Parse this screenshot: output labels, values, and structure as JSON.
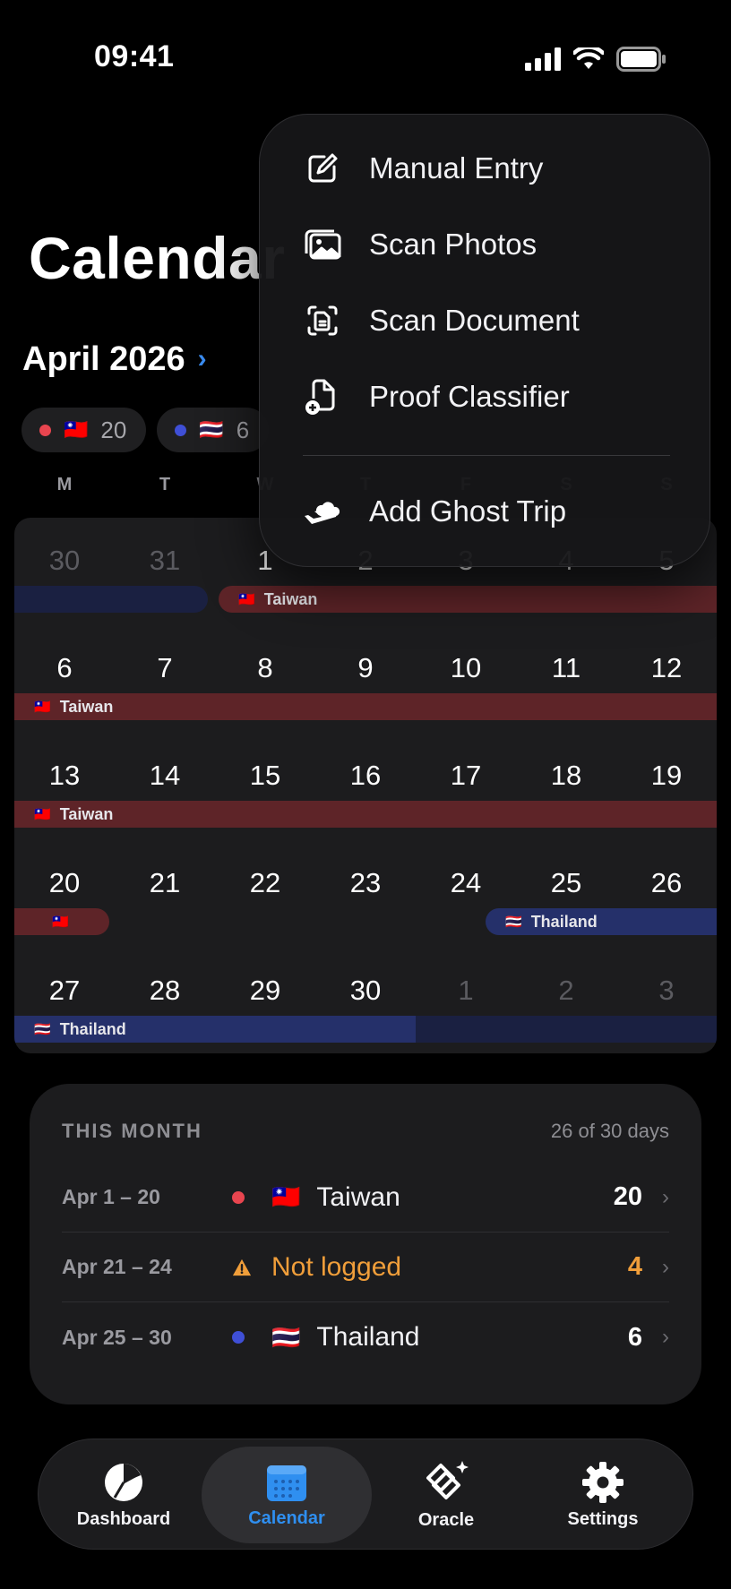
{
  "status_bar": {
    "time": "09:41"
  },
  "page": {
    "title": "Calendar"
  },
  "month": {
    "label": "April 2026"
  },
  "chips": [
    {
      "dot_color": "#e8454f",
      "flag": "🇹🇼",
      "count": "20"
    },
    {
      "dot_color": "#3f4fd6",
      "flag": "🇹🇭",
      "count": "6"
    }
  ],
  "weekdays": [
    "M",
    "T",
    "W",
    "T",
    "F",
    "S",
    "S"
  ],
  "calendar": {
    "weeks": [
      {
        "days": [
          "30",
          "31",
          "1",
          "2",
          "3",
          "4",
          "5"
        ],
        "muted": [
          0,
          1
        ]
      },
      {
        "days": [
          "6",
          "7",
          "8",
          "9",
          "10",
          "11",
          "12"
        ],
        "muted": []
      },
      {
        "days": [
          "13",
          "14",
          "15",
          "16",
          "17",
          "18",
          "19"
        ],
        "muted": []
      },
      {
        "days": [
          "20",
          "21",
          "22",
          "23",
          "24",
          "25",
          "26"
        ],
        "muted": []
      },
      {
        "days": [
          "27",
          "28",
          "29",
          "30",
          "1",
          "2",
          "3"
        ],
        "muted": [
          4,
          5,
          6
        ]
      }
    ],
    "trips": [
      {
        "week": 0,
        "start": 0,
        "end": 1,
        "color": "blue",
        "faded": true,
        "flag": "",
        "label": ""
      },
      {
        "week": 0,
        "start": 2,
        "end": 6,
        "color": "red",
        "faded": false,
        "flag": "🇹🇼",
        "label": "Taiwan"
      },
      {
        "week": 1,
        "start": 0,
        "end": 6,
        "color": "red",
        "faded": false,
        "flag": "🇹🇼",
        "label": "Taiwan"
      },
      {
        "week": 2,
        "start": 0,
        "end": 6,
        "color": "red",
        "faded": false,
        "flag": "🇹🇼",
        "label": "Taiwan"
      },
      {
        "week": 3,
        "start": 0,
        "end": 0,
        "color": "red",
        "faded": false,
        "flag": "🇹🇼",
        "label": ""
      },
      {
        "week": 3,
        "start": 5,
        "end": 6,
        "color": "blue",
        "faded": false,
        "flag": "🇹🇭",
        "label": "Thailand"
      },
      {
        "week": 4,
        "start": 0,
        "end": 3,
        "color": "blue",
        "faded": false,
        "flag": "🇹🇭",
        "label": "Thailand"
      },
      {
        "week": 4,
        "start": 4,
        "end": 6,
        "color": "blue",
        "faded": true,
        "flag": "",
        "label": ""
      }
    ]
  },
  "menu": {
    "items": [
      {
        "label": "Manual Entry",
        "icon": "compose-icon"
      },
      {
        "label": "Scan Photos",
        "icon": "photos-icon"
      },
      {
        "label": "Scan Document",
        "icon": "scan-document-icon"
      },
      {
        "label": "Proof Classifier",
        "icon": "doc-badge-plus-icon"
      }
    ],
    "ghost": {
      "label": "Add Ghost Trip",
      "icon": "airplane-cloud-icon"
    }
  },
  "this_month": {
    "title": "THIS MONTH",
    "count": "26 of 30 days",
    "rows": [
      {
        "range": "Apr 1 – 20",
        "dot_color": "#e8454f",
        "flag": "🇹🇼",
        "country": "Taiwan",
        "days": "20",
        "warn": false
      },
      {
        "range": "Apr 21 – 24",
        "dot_color": "",
        "flag": "",
        "country": "Not logged",
        "days": "4",
        "warn": true
      },
      {
        "range": "Apr 25 – 30",
        "dot_color": "#3f4fd6",
        "flag": "🇹🇭",
        "country": "Thailand",
        "days": "6",
        "warn": false
      }
    ]
  },
  "tabbar": {
    "tabs": [
      {
        "label": "Dashboard",
        "icon": "pie-chart-icon",
        "active": false
      },
      {
        "label": "Calendar",
        "icon": "calendar-icon",
        "active": true
      },
      {
        "label": "Oracle",
        "icon": "oracle-sparkle-icon",
        "active": false
      },
      {
        "label": "Settings",
        "icon": "gear-icon",
        "active": false
      }
    ]
  },
  "colors": {
    "accent": "#2f8ff0",
    "warning": "#f09e3a",
    "taiwan": "#5e2428",
    "thailand": "#25306a"
  }
}
